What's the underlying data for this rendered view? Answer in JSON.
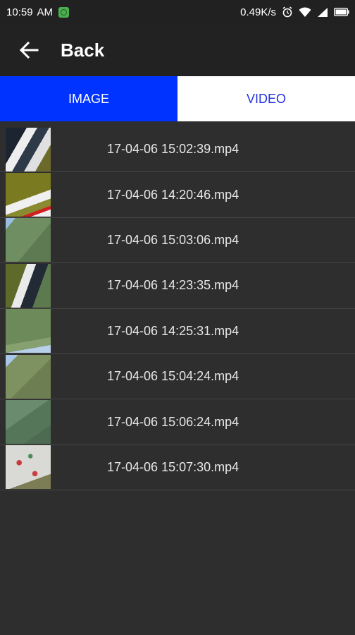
{
  "status_bar": {
    "time": "10:59",
    "ampm": "AM",
    "network_speed": "0.49K/s",
    "icons": [
      "app-notification-icon",
      "alarm-icon",
      "wifi-icon",
      "signal-icon",
      "battery-icon"
    ]
  },
  "app_bar": {
    "back_icon": "arrow-left-icon",
    "title": "Back"
  },
  "tabs": [
    {
      "label": "IMAGE",
      "active": true
    },
    {
      "label": "VIDEO",
      "active": false
    }
  ],
  "colors": {
    "active_tab": "#0033ff",
    "inactive_tab_text": "#2233dd",
    "background": "#2e2e2e"
  },
  "files": [
    {
      "name": "17-04-06 15:02:39.mp4"
    },
    {
      "name": "17-04-06 14:20:46.mp4"
    },
    {
      "name": "17-04-06 15:03:06.mp4"
    },
    {
      "name": "17-04-06 14:23:35.mp4"
    },
    {
      "name": "17-04-06 14:25:31.mp4"
    },
    {
      "name": "17-04-06 15:04:24.mp4"
    },
    {
      "name": "17-04-06 15:06:24.mp4"
    },
    {
      "name": "17-04-06 15:07:30.mp4"
    }
  ]
}
